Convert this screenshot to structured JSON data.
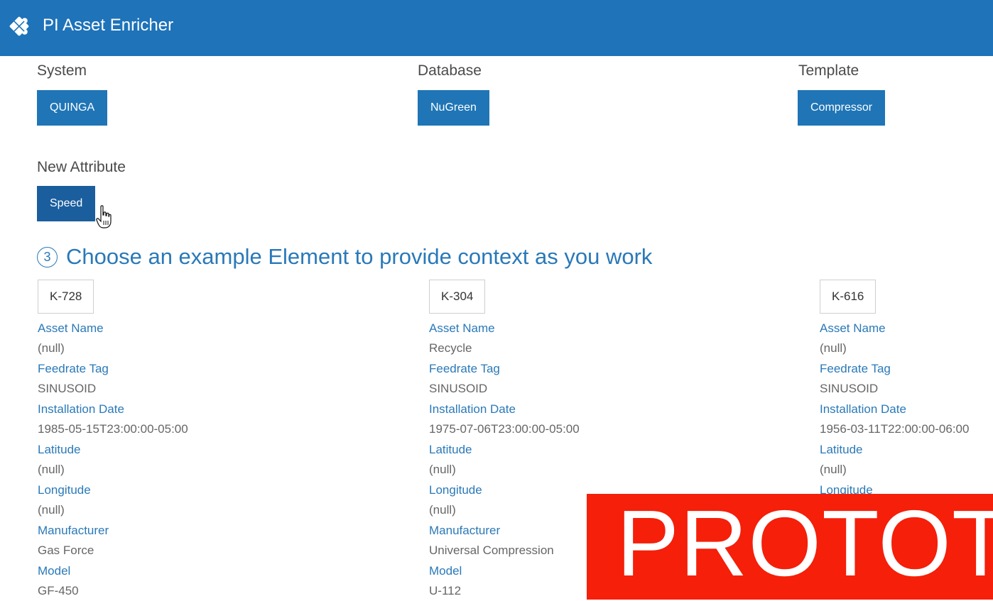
{
  "app": {
    "title": "PI Asset Enricher",
    "logo_icon": "puzzle-icon"
  },
  "selectors": {
    "system": {
      "label": "System",
      "value": "QUINGA"
    },
    "database": {
      "label": "Database",
      "value": "NuGreen"
    },
    "template": {
      "label": "Template",
      "value": "Compressor"
    },
    "new_attribute": {
      "label": "New Attribute",
      "value": "Speed"
    }
  },
  "step": {
    "number": "3",
    "title": "Choose an example Element to provide context as you work"
  },
  "elements": [
    {
      "name": "K-728",
      "attributes": [
        {
          "name": "Asset Name",
          "value": "(null)"
        },
        {
          "name": "Feedrate Tag",
          "value": "SINUSOID"
        },
        {
          "name": "Installation Date",
          "value": "1985-05-15T23:00:00-05:00"
        },
        {
          "name": "Latitude",
          "value": "(null)"
        },
        {
          "name": "Longitude",
          "value": "(null)"
        },
        {
          "name": "Manufacturer",
          "value": "Gas Force"
        },
        {
          "name": "Model",
          "value": "GF-450"
        }
      ]
    },
    {
      "name": "K-304",
      "attributes": [
        {
          "name": "Asset Name",
          "value": "Recycle"
        },
        {
          "name": "Feedrate Tag",
          "value": "SINUSOID"
        },
        {
          "name": "Installation Date",
          "value": "1975-07-06T23:00:00-05:00"
        },
        {
          "name": "Latitude",
          "value": "(null)"
        },
        {
          "name": "Longitude",
          "value": "(null)"
        },
        {
          "name": "Manufacturer",
          "value": "Universal Compression"
        },
        {
          "name": "Model",
          "value": "U-112"
        }
      ]
    },
    {
      "name": "K-616",
      "attributes": [
        {
          "name": "Asset Name",
          "value": "(null)"
        },
        {
          "name": "Feedrate Tag",
          "value": "SINUSOID"
        },
        {
          "name": "Installation Date",
          "value": "1956-03-11T22:00:00-06:00"
        },
        {
          "name": "Latitude",
          "value": "(null)"
        },
        {
          "name": "Longitude",
          "value": ""
        }
      ]
    }
  ],
  "overlay": {
    "text": "PROTOTY"
  },
  "colors": {
    "header": "#1e73b9",
    "button": "#1f75b6",
    "link": "#2a79b8",
    "overlay": "#f51f0a"
  }
}
